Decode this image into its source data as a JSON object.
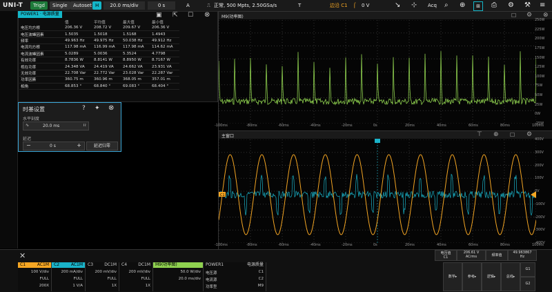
{
  "toolbar": {
    "logo": "UNI-T",
    "trigd": "Trigd",
    "single": "Single",
    "autoset": "Autoset",
    "h": "H",
    "timebase": "20.0 ms/div",
    "delay": "0 s",
    "a": "A",
    "acq_info": "正常, 500 Mpts, 2.50GSa/s",
    "t": "T",
    "edge": "边沿 C1",
    "level": "0 V",
    "acq": "Acq"
  },
  "power_panel": {
    "tab": "POWER1 · 电源质量",
    "headers": [
      "",
      "值",
      "平均值",
      "最大值",
      "最小值"
    ],
    "rows": [
      [
        "电压均方根",
        "206.36 V",
        "208.72 V",
        "209.67 V",
        "206.36 V"
      ],
      [
        "电压波峰因素",
        "1.5035",
        "1.5018",
        "1.5168",
        "1.4943"
      ],
      [
        "频率",
        "49.963 Hz",
        "49.975 Hz",
        "50.038 Hz",
        "49.912 Hz"
      ],
      [
        "电流均方根",
        "117.98 mA",
        "116.99 mA",
        "117.98 mA",
        "114.62 mA"
      ],
      [
        "电流波峰因素",
        "5.0289",
        "5.0036",
        "5.3524",
        "4.7798"
      ],
      [
        "有效功率",
        "8.7836 W",
        "8.8141 W",
        "8.8950 W",
        "8.7167 W"
      ],
      [
        "视在功率",
        "24.348 VA",
        "24.419 VA",
        "24.662 VA",
        "23.931 VA"
      ],
      [
        "无效功率",
        "22.708 Var",
        "22.772 Var",
        "23.028 Var",
        "22.287 Var"
      ],
      [
        "功率因素",
        "360.75 m",
        "360.96 m",
        "368.05 m",
        "357.01 m"
      ],
      [
        "相角",
        "68.853 °",
        "68.840 °",
        "69.083 °",
        "68.404 °"
      ]
    ]
  },
  "time_dialog": {
    "title": "时基设置",
    "horiz_label": "水平刻度",
    "horiz_value": "20.0 ms",
    "delay_label": "延迟",
    "delay_value": "0 s",
    "reset": "延迟归零"
  },
  "upper_window": {
    "title": "M9(功率图)",
    "yticks": [
      "250W",
      "225W",
      "200W",
      "175W",
      "150W",
      "125W",
      "100W",
      "75W",
      "50W",
      "25W",
      "0W",
      "-25W"
    ],
    "xticks": [
      "-100ms",
      "-80ms",
      "-60ms",
      "-40ms",
      "-20ms",
      "0s",
      "20ms",
      "40ms",
      "60ms",
      "80ms",
      "100ms"
    ]
  },
  "main_window": {
    "title": "主窗口",
    "yticks": [
      "400V",
      "300V",
      "200V",
      "100V",
      "0V",
      "-100V",
      "-200V",
      "-300V",
      "-400V"
    ],
    "xticks": [
      "-100ms",
      "-80ms",
      "-60ms",
      "-40ms",
      "-20ms",
      "0s",
      "20ms",
      "40ms",
      "60ms",
      "80ms",
      "100ms"
    ]
  },
  "channels": [
    {
      "name": "C1",
      "cpl": "AC1M",
      "scale": "100 V/div",
      "bw": "FULL",
      "probe": "200X",
      "color": "#f5a623"
    },
    {
      "name": "C2",
      "cpl": "AC1M",
      "scale": "200 mA/div",
      "bw": "FULL",
      "probe": "1 V/A",
      "color": "#1ab3c9"
    },
    {
      "name": "C3",
      "cpl": "DC1M",
      "scale": "200 mV/div",
      "bw": "FULL",
      "probe": "1X",
      "color": "#1a1a1a"
    },
    {
      "name": "C4",
      "cpl": "DC1M",
      "scale": "200 mV/div",
      "bw": "FULL",
      "probe": "1X",
      "color": "#1a1a1a"
    }
  ],
  "math": {
    "name": "M9(功率图)",
    "scale": "50.0 W/div",
    "scale2": "20.0 ms/div",
    "color": "#8fd14f"
  },
  "power_chan": {
    "name": "POWER1",
    "type": "电源质量",
    "rows": [
      [
        "电压源",
        "C1"
      ],
      [
        "电流源",
        "C2"
      ],
      [
        "功率型",
        "M9"
      ]
    ]
  },
  "readouts": [
    {
      "label": "电压值",
      "sub": "C1",
      "value": "206.61 V",
      "unit": "ACrms"
    },
    {
      "label": "频率值",
      "sub": "",
      "value": "49.963867",
      "unit": "Hz"
    }
  ],
  "bottom_buttons": [
    "数学",
    "参考",
    "逻辑",
    "总线"
  ],
  "g_buttons": [
    "G1",
    "G2"
  ]
}
